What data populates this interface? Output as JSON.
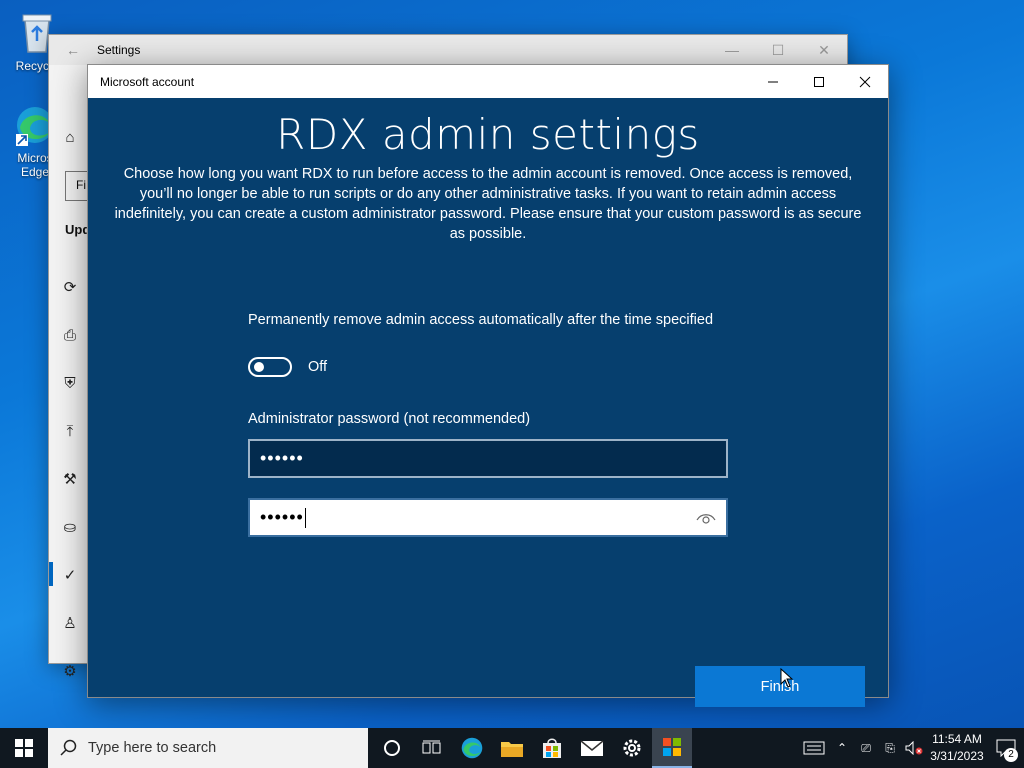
{
  "desktop": {
    "icons": [
      {
        "label": "Recycle",
        "icon": "recycle-bin-icon"
      },
      {
        "label": "Microsoft Edge",
        "label_line1": "Micros",
        "label_line2": "Edge",
        "icon": "edge-icon"
      }
    ]
  },
  "settings_window": {
    "title": "Settings",
    "search_fragment": "Fi",
    "section_fragment": "Upd",
    "sidebar_icons": [
      "home-icon",
      "sync-icon",
      "delivery-icon",
      "shield-icon",
      "backup-icon",
      "troubleshoot-icon",
      "recovery-icon",
      "activation-icon",
      "find-device-icon",
      "developer-icon"
    ]
  },
  "dialog": {
    "window_title": "Microsoft account",
    "heading": "RDX admin settings",
    "description": "Choose how long you want RDX to run before access to the admin account is removed. Once access is removed, you’ll no longer be able to run scripts or do any other administrative tasks. If you want to retain admin access indefinitely, you can create a custom administrator password. Please ensure that your custom password is as secure as possible.",
    "toggle_label": "Permanently remove admin access automatically after the time specified",
    "toggle_state": "Off",
    "password_label": "Administrator password (not recommended)",
    "password_value": "••••••",
    "confirm_password_value": "••••••",
    "finish_label": "Finish",
    "colors": {
      "background": "#063f6e",
      "button": "#0b78d4"
    }
  },
  "taskbar": {
    "search_placeholder": "Type here to search",
    "apps": [
      "cortana-icon",
      "task-view-icon",
      "edge-icon",
      "file-explorer-icon",
      "store-icon",
      "mail-icon",
      "settings-icon",
      "microsoft-account-icon"
    ],
    "time": "11:54 AM",
    "date": "3/31/2023",
    "notification_count": "2"
  }
}
